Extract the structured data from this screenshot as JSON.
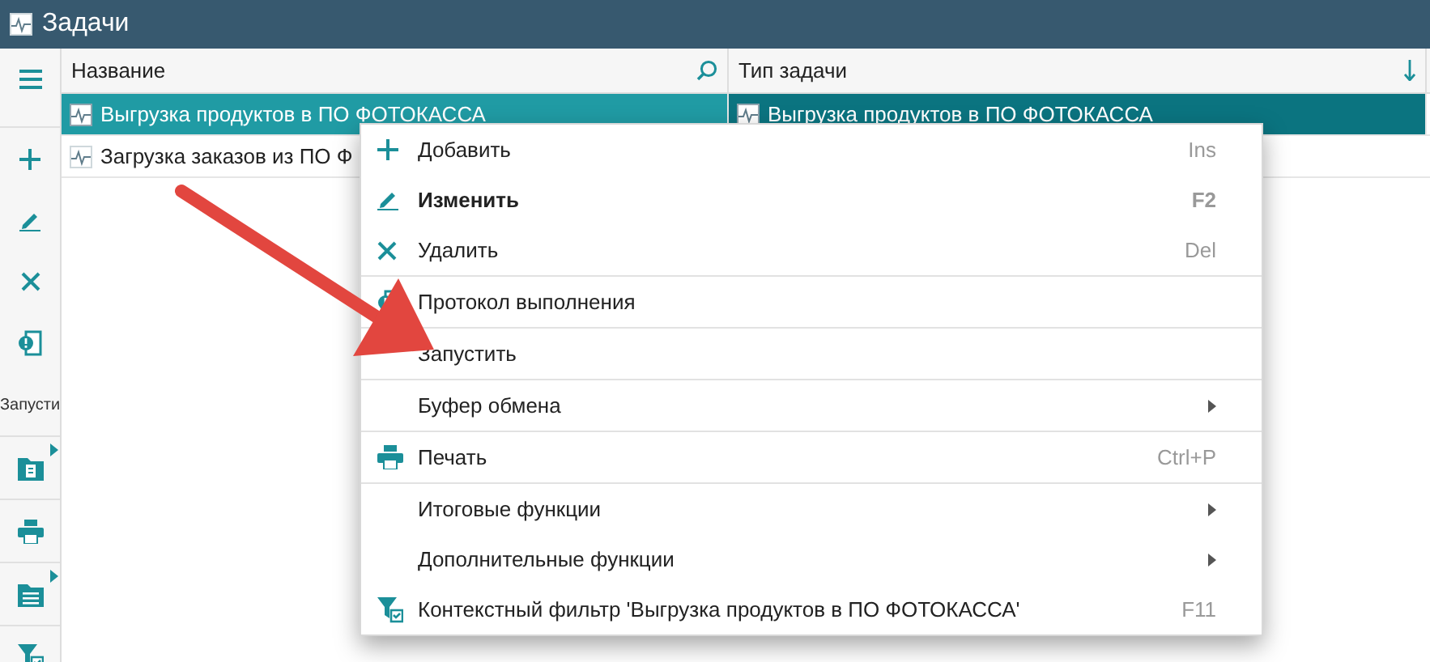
{
  "window": {
    "title": "Задачи"
  },
  "sidebar": {
    "groups": [
      [
        {
          "kind": "icon",
          "submenu": false
        }
      ],
      [
        {
          "kind": "icon",
          "submenu": false
        },
        {
          "kind": "icon",
          "submenu": false
        },
        {
          "kind": "icon",
          "submenu": false
        },
        {
          "kind": "icon",
          "submenu": false
        },
        {
          "kind": "text",
          "label": "Запусти",
          "submenu": false
        }
      ],
      [
        {
          "kind": "icon",
          "submenu": true
        }
      ],
      [
        {
          "kind": "icon",
          "submenu": false
        }
      ],
      [
        {
          "kind": "icon",
          "submenu": true
        }
      ],
      [
        {
          "kind": "icon",
          "submenu": false
        }
      ]
    ]
  },
  "table": {
    "columns": [
      "Название",
      "Тип задачи"
    ],
    "rows": [
      {
        "selected": true,
        "cells": [
          "Выгрузка продуктов в ПО ФОТОКАССА",
          "Выгрузка продуктов в ПО ФОТОКАССА"
        ]
      },
      {
        "selected": false,
        "cells": [
          "Загрузка заказов из ПО Ф"
        ]
      }
    ]
  },
  "context_menu": {
    "groups": [
      [
        {
          "label": "Добавить",
          "shortcut": "Ins",
          "default": false,
          "submenu": false
        },
        {
          "label": "Изменить",
          "shortcut": "F2",
          "default": true,
          "submenu": false
        },
        {
          "label": "Удалить",
          "shortcut": "Del",
          "default": false,
          "submenu": false
        }
      ],
      [
        {
          "label": "Протокол выполнения",
          "default": false,
          "submenu": false
        }
      ],
      [
        {
          "label": "Запустить",
          "default": false,
          "submenu": false
        }
      ],
      [
        {
          "label": "Буфер обмена",
          "default": false,
          "submenu": true
        }
      ],
      [
        {
          "label": "Печать",
          "shortcut": "Ctrl+P",
          "default": false,
          "submenu": false
        }
      ],
      [
        {
          "label": "Итоговые функции",
          "default": false,
          "submenu": true
        },
        {
          "label": "Дополнительные функции",
          "default": false,
          "submenu": true
        },
        {
          "label": "Контекстный фильтр 'Выгрузка продуктов в ПО ФОТОКАССА'",
          "shortcut": "F11",
          "default": false,
          "submenu": false
        }
      ]
    ]
  }
}
